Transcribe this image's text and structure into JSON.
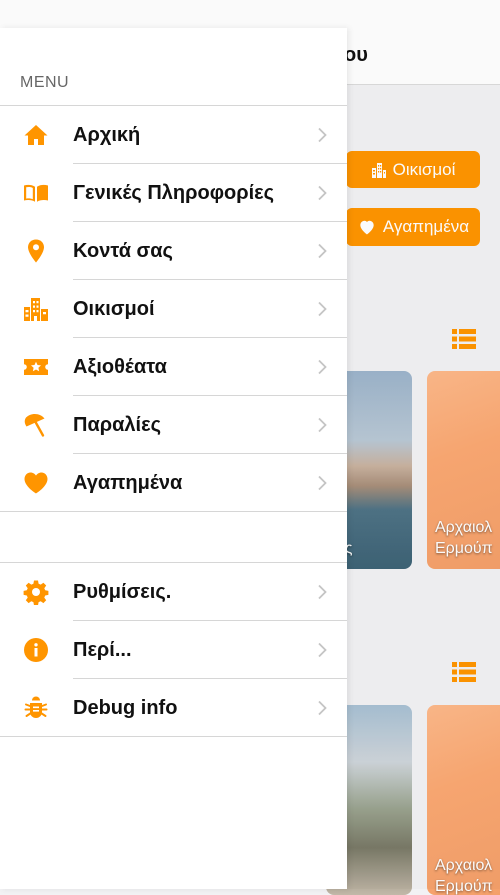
{
  "page": {
    "title_partial": "ύρου",
    "buttons": {
      "settlements": "Οικισμοί",
      "favorites": "Αγαπημένα"
    },
    "cards": [
      {
        "caption": "ίες"
      },
      {
        "caption_line1": "Αρχαιολ",
        "caption_line2": "Ερμούπ"
      },
      {
        "caption": ""
      },
      {
        "caption_line1": "Αρχαιολ",
        "caption_line2": "Ερμούπ"
      }
    ]
  },
  "menu": {
    "header": "MENU",
    "accent_color": "#ff9500",
    "primary_items": [
      {
        "label": "Αρχική",
        "icon": "home-icon"
      },
      {
        "label": "Γενικές Πληροφορίες",
        "icon": "book-icon"
      },
      {
        "label": "Κοντά σας",
        "icon": "location-pin-icon"
      },
      {
        "label": "Οικισμοί",
        "icon": "buildings-icon"
      },
      {
        "label": "Αξιοθέατα",
        "icon": "ticket-star-icon"
      },
      {
        "label": "Παραλίες",
        "icon": "beach-umbrella-icon"
      },
      {
        "label": "Αγαπημένα",
        "icon": "heart-icon"
      }
    ],
    "secondary_items": [
      {
        "label": "Ρυθμίσεις.",
        "icon": "gear-icon"
      },
      {
        "label": "Περί...",
        "icon": "info-icon"
      },
      {
        "label": "Debug info",
        "icon": "bug-icon"
      }
    ]
  }
}
